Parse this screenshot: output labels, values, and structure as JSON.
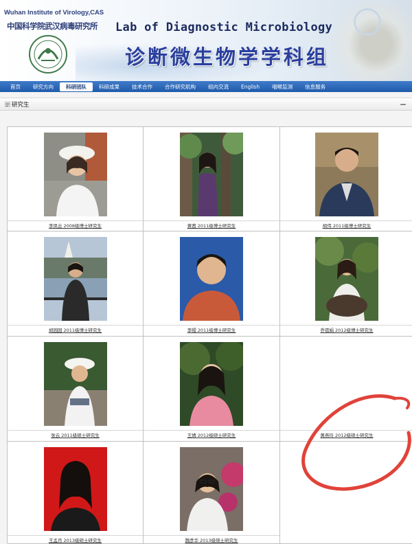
{
  "banner": {
    "institute_en": "Wuhan Institute of Virology,CAS",
    "institute_cn": "中国科学院武汉病毒研究所",
    "lab_title_en": "Lab of Diagnostic Microbiology",
    "lab_title_cn": "诊断微生物学学科组",
    "logo_icon": "institute-seal"
  },
  "nav": {
    "items": [
      {
        "label": "首页"
      },
      {
        "label": "研究方向"
      },
      {
        "label": "科研团队",
        "active": true
      },
      {
        "label": "科研成果"
      },
      {
        "label": "技术合作"
      },
      {
        "label": "合作研究机构"
      },
      {
        "label": "组内交流"
      },
      {
        "label": "English"
      },
      {
        "label": "咽喉监测"
      },
      {
        "label": "信息服务"
      }
    ]
  },
  "section": {
    "title": "研究生",
    "collapse": "－",
    "icon": "list-icon"
  },
  "students": [
    {
      "caption": "李凤云  2008级博士研究生"
    },
    {
      "caption": "黄茜  2011级博士研究生"
    },
    {
      "caption": "胡伟  2011级博士研究生"
    },
    {
      "caption": "胡园园  2011级博士研究生"
    },
    {
      "caption": "李帽  2011级博士研究生"
    },
    {
      "caption": "乔蓓娟  2012级博士研究生"
    },
    {
      "caption": "张云 2011级硕士研究生"
    },
    {
      "caption": "王婧 2012级硕士研究生"
    },
    {
      "caption": "黄燕玲 2012级硕士研究生"
    },
    {
      "caption": "王孟月 2013级硕士研究生"
    },
    {
      "caption": "魏彦华 2013级硕士研究生"
    }
  ],
  "colors": {
    "nav_bg": "#1f5bab",
    "annotation": "#e0433a"
  }
}
